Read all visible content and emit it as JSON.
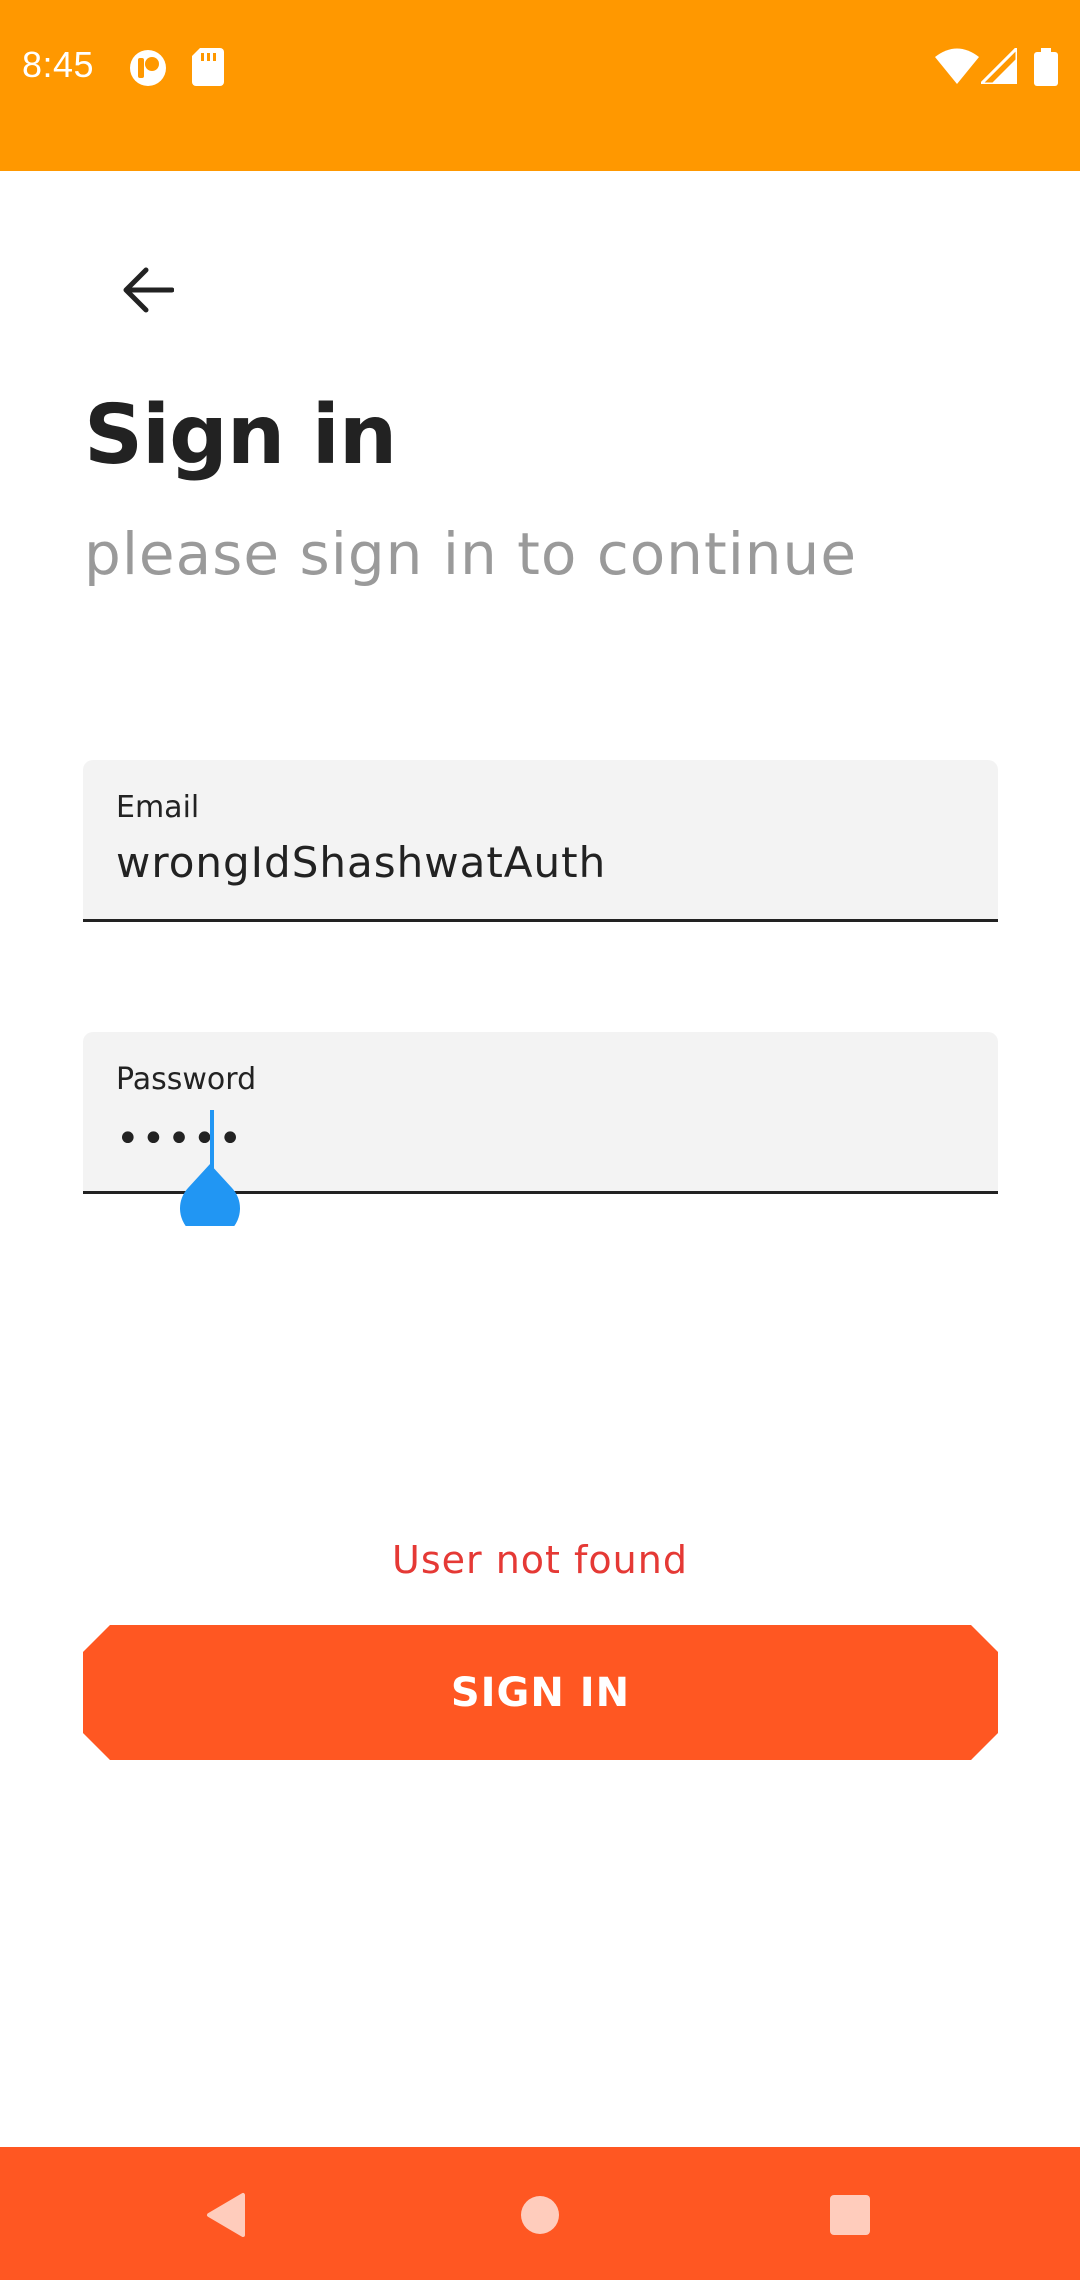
{
  "status_bar": {
    "time": "8:45",
    "color": "#FF9800",
    "left_icons": [
      "app-notification-icon",
      "sd-card-icon"
    ],
    "right_icons": [
      "wifi-icon",
      "cell-signal-icon",
      "battery-icon"
    ]
  },
  "header": {
    "back_icon": "arrow-left-icon",
    "title": "Sign in",
    "subtitle": "please sign in to continue"
  },
  "form": {
    "email": {
      "label": "Email",
      "value": "wrongIdShashwatAuth"
    },
    "password": {
      "label": "Password",
      "value_masked": "•••••"
    },
    "error_message": "User not found",
    "submit_label": "SIGN IN"
  },
  "colors": {
    "accent": "#FF5722",
    "status": "#FF9800",
    "error": "#E53935",
    "cursor": "#2196F3"
  },
  "nav_bar": {
    "buttons": [
      "back-triangle-icon",
      "home-circle-icon",
      "recents-square-icon"
    ]
  }
}
